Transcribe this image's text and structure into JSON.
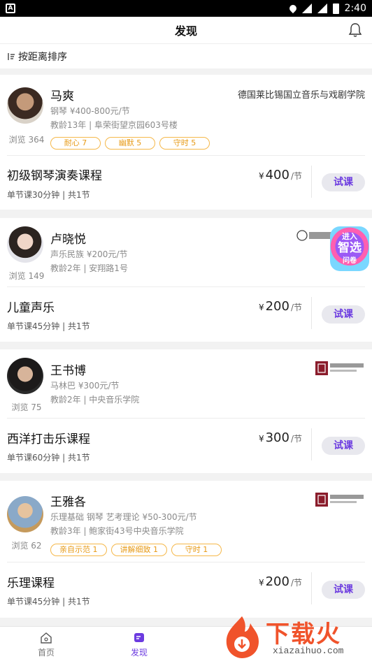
{
  "status_bar": {
    "time": "2:40",
    "left_icon": "A"
  },
  "header": {
    "title": "发现"
  },
  "sort": {
    "label": "按距离排序"
  },
  "cards": [
    {
      "name": "马爽",
      "school": "德国莱比锡国立音乐与戏剧学院",
      "line1": "钢琴 ¥400-800元/节",
      "line2": "教龄13年 | 阜荣街望京园603号楼",
      "views": "浏览 364",
      "tags": [
        "耐心 7",
        "幽默 5",
        "守时 5"
      ],
      "course": "初级钢琴演奏课程",
      "meta": "单节课30分钟 | 共1节",
      "price_currency": "¥",
      "price": "400",
      "price_unit": "/节",
      "trial": "试课"
    },
    {
      "name": "卢晓悦",
      "school": "",
      "line1": "声乐民族 ¥200元/节",
      "line2": "教龄2年 | 安翔路1号",
      "views": "浏览 149",
      "tags": [],
      "course": "儿童声乐",
      "meta": "单节课45分钟 | 共1节",
      "price_currency": "¥",
      "price": "200",
      "price_unit": "/节",
      "trial": "试课",
      "badge": {
        "line1": "进入",
        "line2": "智选",
        "line3": "问卷"
      }
    },
    {
      "name": "王书博",
      "school": "",
      "line1": "马林巴 ¥300元/节",
      "line2": "教龄2年 | 中央音乐学院",
      "views": "浏览 75",
      "tags": [],
      "course": "西洋打击乐课程",
      "meta": "单节课60分钟 | 共1节",
      "price_currency": "¥",
      "price": "300",
      "price_unit": "/节",
      "trial": "试课"
    },
    {
      "name": "王雅各",
      "school": "",
      "line1": "乐理基础 钢琴 艺考理论 ¥50-300元/节",
      "line2": "教龄3年 | 鲍家街43号中央音乐学院",
      "views": "浏览 62",
      "tags": [
        "亲自示范 1",
        "讲解细致 1",
        "守时 1"
      ],
      "course": "乐理课程",
      "meta": "单节课45分钟 | 共1节",
      "price_currency": "¥",
      "price": "200",
      "price_unit": "/节",
      "trial": "试课"
    }
  ],
  "tabs": [
    {
      "label": "首页",
      "icon": "home-icon"
    },
    {
      "label": "发现",
      "icon": "discover-icon"
    }
  ],
  "watermark": {
    "text": "下载火",
    "url": "xiazaihuo.com"
  },
  "colors": {
    "accent": "#6c3be0",
    "tag": "#e79a16",
    "watermark": "#f0532b"
  }
}
